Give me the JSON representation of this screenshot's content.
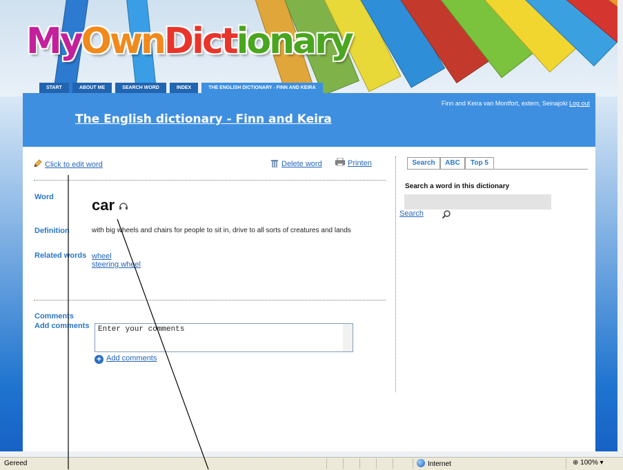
{
  "site": {
    "logo": {
      "my": "My",
      "own": "Own",
      "dict": "Dict",
      "ionary": "ionary"
    },
    "colors": {
      "header_blue": "#3f8fe0",
      "tab_blue": "#2164b0",
      "link_blue": "#2465b8",
      "label_blue": "#2a76c6"
    }
  },
  "nav": {
    "tabs": [
      "START",
      "ABOUT ME",
      "SEARCH WORD",
      "INDEX",
      "THE ENGLISH DICTIONARY - FINN AND KEIRA"
    ]
  },
  "header": {
    "title": "The English dictionary - Finn and Keira",
    "user": "Finn and Keira van Montfort, extern, Seinajoki",
    "logout": "Log out"
  },
  "toolbar": {
    "edit": "Click to edit word",
    "delete": "Delete word",
    "print": "Printen",
    "icons": [
      "pencil-icon",
      "trash-icon",
      "printer-icon"
    ]
  },
  "entry": {
    "word_label": "Word",
    "word": "car",
    "audio_icon": "headphones-icon",
    "definition_label": "Definition",
    "definition": "with big wheels and chairs for people to sit in, drive to all sorts of creatures and lands",
    "related_label": "Related words",
    "related": [
      "wheel",
      "steering wheel"
    ]
  },
  "comments": {
    "label": "Comments",
    "add_label": "Add comments",
    "placeholder": "Enter your comments",
    "add_link": "Add comments"
  },
  "sidebar": {
    "tabs": [
      "Search",
      "ABC",
      "Top 5"
    ],
    "search_heading": "Search a word in this dictionary",
    "search_value": "",
    "search_link": "Search"
  },
  "statusbar": {
    "status": "Gereed",
    "zone": "Internet",
    "zoom": "100%"
  }
}
